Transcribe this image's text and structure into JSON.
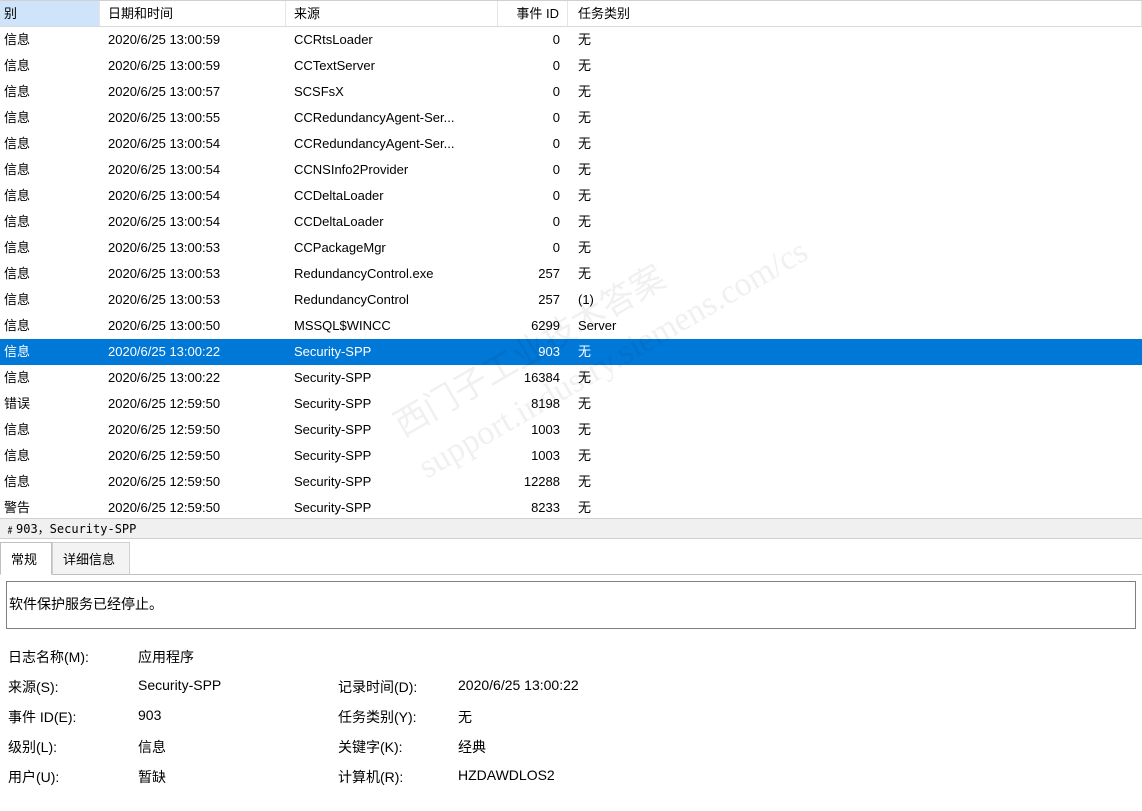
{
  "columns": {
    "level": "别",
    "date": "日期和时间",
    "source": "来源",
    "id": "事件 ID",
    "task": "任务类别"
  },
  "events": [
    {
      "level": "信息",
      "date": "2020/6/25 13:00:59",
      "source": "CCRtsLoader",
      "id": "0",
      "task": "无",
      "selected": false
    },
    {
      "level": "信息",
      "date": "2020/6/25 13:00:59",
      "source": "CCTextServer",
      "id": "0",
      "task": "无",
      "selected": false
    },
    {
      "level": "信息",
      "date": "2020/6/25 13:00:57",
      "source": "SCSFsX",
      "id": "0",
      "task": "无",
      "selected": false
    },
    {
      "level": "信息",
      "date": "2020/6/25 13:00:55",
      "source": "CCRedundancyAgent-Ser...",
      "id": "0",
      "task": "无",
      "selected": false
    },
    {
      "level": "信息",
      "date": "2020/6/25 13:00:54",
      "source": "CCRedundancyAgent-Ser...",
      "id": "0",
      "task": "无",
      "selected": false
    },
    {
      "level": "信息",
      "date": "2020/6/25 13:00:54",
      "source": "CCNSInfo2Provider",
      "id": "0",
      "task": "无",
      "selected": false
    },
    {
      "level": "信息",
      "date": "2020/6/25 13:00:54",
      "source": "CCDeltaLoader",
      "id": "0",
      "task": "无",
      "selected": false
    },
    {
      "level": "信息",
      "date": "2020/6/25 13:00:54",
      "source": "CCDeltaLoader",
      "id": "0",
      "task": "无",
      "selected": false
    },
    {
      "level": "信息",
      "date": "2020/6/25 13:00:53",
      "source": "CCPackageMgr",
      "id": "0",
      "task": "无",
      "selected": false
    },
    {
      "level": "信息",
      "date": "2020/6/25 13:00:53",
      "source": "RedundancyControl.exe",
      "id": "257",
      "task": "无",
      "selected": false
    },
    {
      "level": "信息",
      "date": "2020/6/25 13:00:53",
      "source": "RedundancyControl",
      "id": "257",
      "task": "(1)",
      "selected": false
    },
    {
      "level": "信息",
      "date": "2020/6/25 13:00:50",
      "source": "MSSQL$WINCC",
      "id": "6299",
      "task": "Server",
      "selected": false
    },
    {
      "level": "信息",
      "date": "2020/6/25 13:00:22",
      "source": "Security-SPP",
      "id": "903",
      "task": "无",
      "selected": true
    },
    {
      "level": "信息",
      "date": "2020/6/25 13:00:22",
      "source": "Security-SPP",
      "id": "16384",
      "task": "无",
      "selected": false
    },
    {
      "level": "错误",
      "date": "2020/6/25 12:59:50",
      "source": "Security-SPP",
      "id": "8198",
      "task": "无",
      "selected": false
    },
    {
      "level": "信息",
      "date": "2020/6/25 12:59:50",
      "source": "Security-SPP",
      "id": "1003",
      "task": "无",
      "selected": false
    },
    {
      "level": "信息",
      "date": "2020/6/25 12:59:50",
      "source": "Security-SPP",
      "id": "1003",
      "task": "无",
      "selected": false
    },
    {
      "level": "信息",
      "date": "2020/6/25 12:59:50",
      "source": "Security-SPP",
      "id": "12288",
      "task": "无",
      "selected": false
    },
    {
      "level": "警告",
      "date": "2020/6/25 12:59:50",
      "source": "Security-SPP",
      "id": "8233",
      "task": "无",
      "selected": false,
      "cutoff": true
    }
  ],
  "detail_title": "﹟903，Security-SPP",
  "tabs": {
    "general": "常规",
    "details": "详细信息"
  },
  "detail_message": "软件保护服务已经停止。",
  "kv": {
    "logname_label": "日志名称(M):",
    "logname_value": "应用程序",
    "source_label": "来源(S):",
    "source_value": "Security-SPP",
    "record_label": "记录时间(D):",
    "record_value": "2020/6/25 13:00:22",
    "eventid_label": "事件 ID(E):",
    "eventid_value": "903",
    "taskcat_label": "任务类别(Y):",
    "taskcat_value": "无",
    "level_label": "级别(L):",
    "level_value": "信息",
    "keywords_label": "关键字(K):",
    "keywords_value": "经典",
    "user_label": "用户(U):",
    "user_value": "暂缺",
    "computer_label": "计算机(R):",
    "computer_value": "HZDAWDLOS2"
  },
  "watermark": "西门子工业技术答案\nsupport.industry.siemens.com/cs"
}
